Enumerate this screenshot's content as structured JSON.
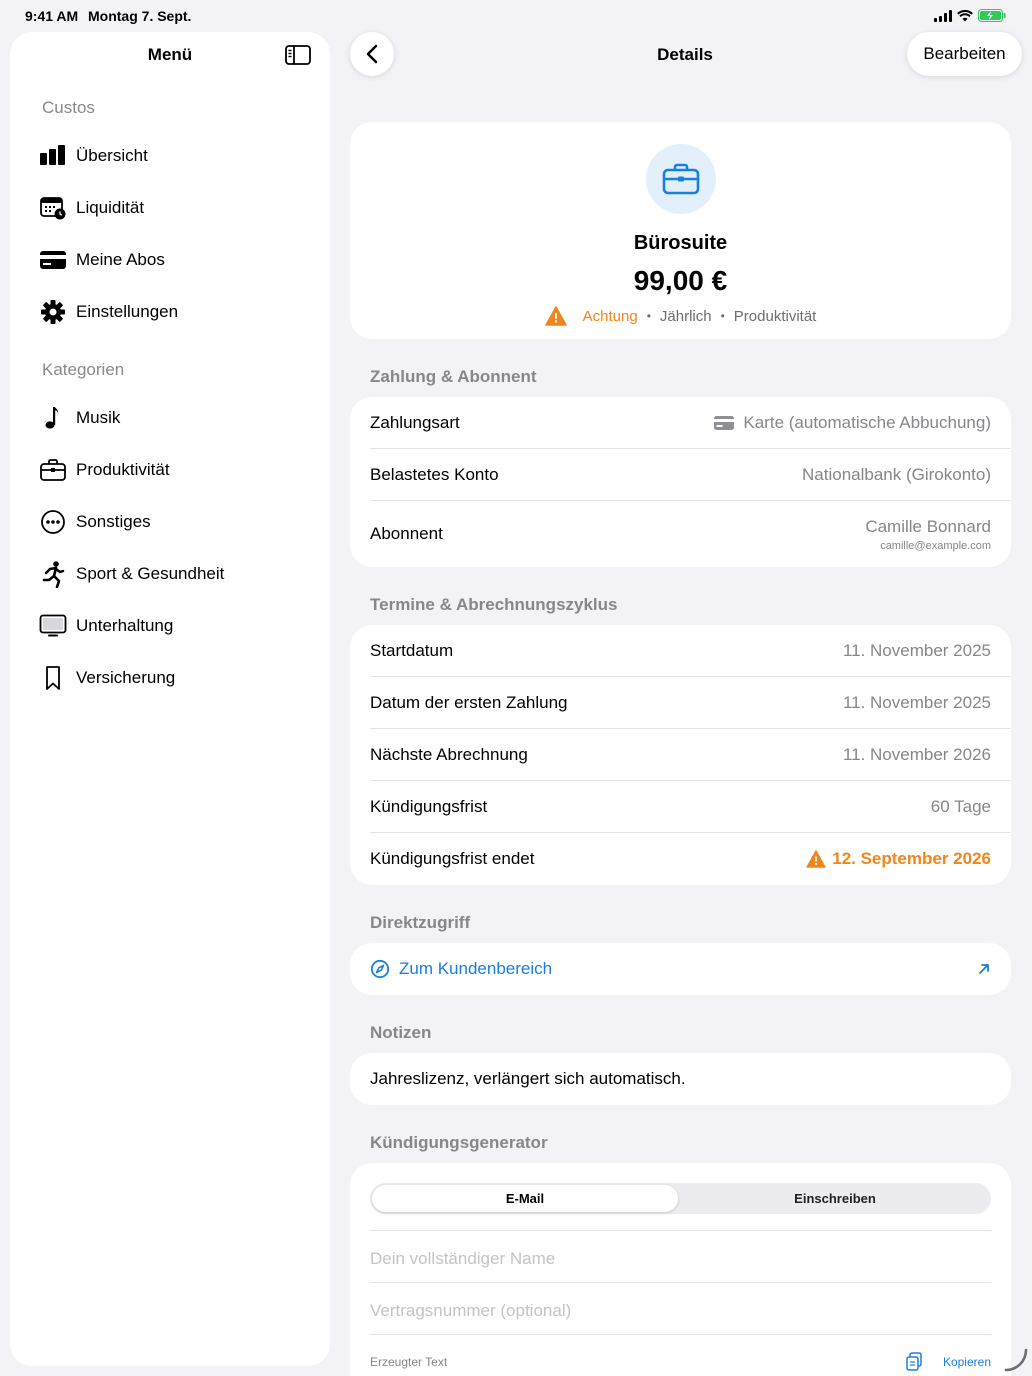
{
  "status": {
    "time": "9:41 AM",
    "date": "Montag 7. Sept."
  },
  "sidebar": {
    "title": "Menü",
    "section_main": "Custos",
    "main_items": [
      {
        "label": "Übersicht",
        "icon": "chart-bar-icon"
      },
      {
        "label": "Liquidität",
        "icon": "calendar-clock-icon"
      },
      {
        "label": "Meine Abos",
        "icon": "credit-card-icon"
      },
      {
        "label": "Einstellungen",
        "icon": "gear-icon"
      }
    ],
    "section_categories": "Kategorien",
    "category_items": [
      {
        "label": "Musik",
        "icon": "music-note-icon"
      },
      {
        "label": "Produktivität",
        "icon": "briefcase-icon"
      },
      {
        "label": "Sonstiges",
        "icon": "ellipsis-circle-icon"
      },
      {
        "label": "Sport & Gesundheit",
        "icon": "running-icon"
      },
      {
        "label": "Unterhaltung",
        "icon": "tv-icon"
      },
      {
        "label": "Versicherung",
        "icon": "bookmark-icon"
      }
    ]
  },
  "nav": {
    "title": "Details",
    "edit_label": "Bearbeiten"
  },
  "header": {
    "name": "Bürosuite",
    "price": "99,00 €",
    "status": "Achtung",
    "cycle": "Jährlich",
    "category": "Produktivität"
  },
  "payment": {
    "section": "Zahlung & Abonnent",
    "method_label": "Zahlungsart",
    "method_value": "Karte (automatische Abbuchung)",
    "account_label": "Belastetes Konto",
    "account_value": "Nationalbank (Girokonto)",
    "subscriber_label": "Abonnent",
    "subscriber_name": "Camille Bonnard",
    "subscriber_email": "camille@example.com"
  },
  "dates": {
    "section": "Termine & Abrechnungszyklus",
    "rows": [
      {
        "label": "Startdatum",
        "value": "11. November 2025"
      },
      {
        "label": "Datum der ersten Zahlung",
        "value": "11. November 2025"
      },
      {
        "label": "Nächste Abrechnung",
        "value": "11. November 2026"
      },
      {
        "label": "Kündigungsfrist",
        "value": "60 Tage"
      }
    ],
    "deadline_label": "Kündigungsfrist endet",
    "deadline_value": "12. September 2026"
  },
  "direct": {
    "section": "Direktzugriff",
    "link_label": "Zum Kundenbereich"
  },
  "notes": {
    "section": "Notizen",
    "text": "Jahreslizenz, verlängert sich automatisch."
  },
  "generator": {
    "section": "Kündigungsgenerator",
    "tab_email": "E-Mail",
    "tab_letter": "Einschreiben",
    "name_placeholder": "Dein vollständiger Name",
    "contract_placeholder": "Vertragsnummer (optional)",
    "generated_label": "Erzeugter Text",
    "copy_label": "Kopieren"
  },
  "colors": {
    "accent": "#1a7fe0",
    "warning": "#f0861a",
    "background": "#f2f2f7"
  }
}
